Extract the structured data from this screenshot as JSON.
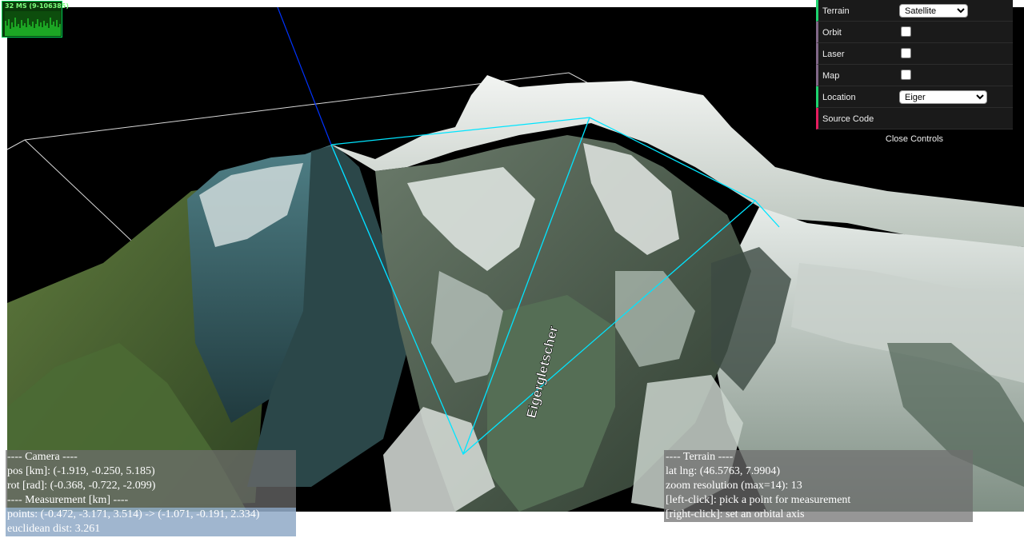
{
  "stats": {
    "text": "32 MS (9-106385)"
  },
  "controls": {
    "terrain": {
      "label": "Terrain",
      "value": "Satellite",
      "options": [
        "Satellite"
      ]
    },
    "orbit": {
      "label": "Orbit",
      "checked": false
    },
    "laser": {
      "label": "Laser",
      "checked": false
    },
    "map": {
      "label": "Map",
      "checked": false
    },
    "location": {
      "label": "Location",
      "value": "Eiger",
      "options": [
        "Eiger"
      ]
    },
    "source": {
      "label": "Source Code"
    },
    "close": "Close Controls"
  },
  "scene": {
    "glacier_label": "Eigergletscher"
  },
  "camera_panel": {
    "header": "---- Camera ----",
    "pos": "pos [km]: (-1.919, -0.250, 5.185)",
    "rot": "rot [rad]: (-0.368, -0.722, -2.099)",
    "meas_header": "---- Measurement [km] ----",
    "points": "points: (-0.472, -3.171, 3.514) -> (-1.071, -0.191, 2.334)",
    "dist": "euclidean dist: 3.261"
  },
  "terrain_panel": {
    "header": "---- Terrain ----",
    "latlng": "lat lng: (46.5763, 7.9904)",
    "zoom": "zoom resolution (max=14): 13",
    "left_click": "[left-click]: pick a point for measurement",
    "right_click": "[right-click]: set an orbital axis"
  },
  "colors": {
    "accent_gui_number": "#2fa1d6",
    "accent_bool": "#806787",
    "accent_func": "#e61d5f",
    "accent_select": "#1ed36f",
    "measure_line": "#00e5ff",
    "axis_line": "#0033ff"
  }
}
